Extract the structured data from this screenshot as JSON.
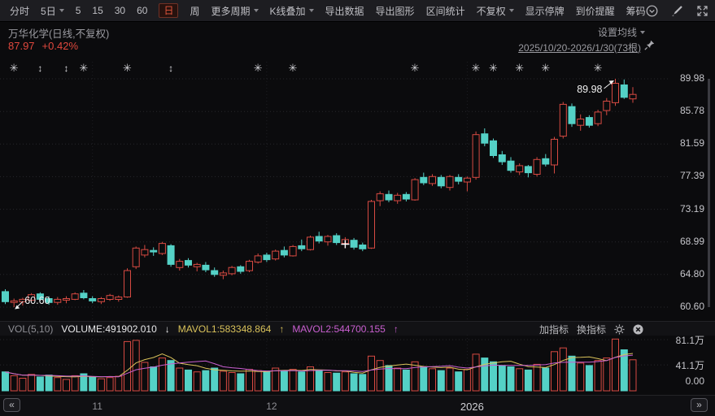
{
  "toolbar": {
    "items": [
      {
        "label": "分时"
      },
      {
        "label": "5日",
        "caret": true
      },
      {
        "label": "5"
      },
      {
        "label": "15"
      },
      {
        "label": "30"
      },
      {
        "label": "60"
      },
      {
        "label": "日",
        "active": true
      },
      {
        "label": "周"
      },
      {
        "label": "更多周期",
        "caret": true
      },
      {
        "label": "K线叠加",
        "caret": true
      },
      {
        "label": "导出数据"
      },
      {
        "label": "导出图形"
      },
      {
        "label": "区间统计"
      },
      {
        "label": "不复权",
        "caret": true
      },
      {
        "label": "显示停牌"
      },
      {
        "label": "到价提醒"
      },
      {
        "label": "筹码"
      }
    ]
  },
  "header": {
    "symbol_title": "万华化学(日线,不复权)",
    "last_price": "87.97",
    "change_pct": "+0.42%",
    "ma_settings": "设置均线",
    "range_label": "2025/10/20-2026/1/30(73根)"
  },
  "vol_header": {
    "indicator": "VOL(5,10)",
    "volume_label": "VOLUME:491902.010",
    "volume_arrow": "↓",
    "mavol1_label": "MAVOL1:583348.864",
    "mavol1_arrow": "↑",
    "mavol2_label": "MAVOL2:544700.155",
    "mavol2_arrow": "↑",
    "add_indicator": "加指标",
    "switch_indicator": "换指标"
  },
  "icons": {
    "star": "✳",
    "updown": "↕",
    "chevrons_left": "«",
    "chevrons_right": "»"
  },
  "colors": {
    "up": "#d74a42",
    "down": "#54d1c6",
    "mavol1": "#d9c25a",
    "mavol2": "#c95fd0",
    "grid": "#27272c",
    "marker": "#d4d4d8",
    "annotation": "#f0f0f0",
    "price_text": "#e0483d",
    "active_tab": "#e2563c"
  },
  "chart_data": {
    "type": "candlestick+volume",
    "symbol": "万华化学",
    "period": "日线",
    "adjustment": "不复权",
    "visible_range": "2025/10/20-2026/1/30",
    "bars_count": 73,
    "last_price": 87.97,
    "change_pct": "+0.42%",
    "price_axis_ticks": [
      "89.98",
      "85.78",
      "81.59",
      "77.39",
      "73.19",
      "68.99",
      "64.80",
      "60.60"
    ],
    "volume_axis_ticks": [
      "81.1万",
      "41.1万",
      "0.00"
    ],
    "x_axis_labels": [
      {
        "label": "11",
        "index": 10
      },
      {
        "label": "12",
        "index": 30
      },
      {
        "label": "2026",
        "index": 53,
        "year": true
      }
    ],
    "annotations": {
      "low_label": "60.60",
      "high_label": "89.98"
    },
    "event_cross": {
      "index": 39,
      "price": 68.7
    },
    "markers": [
      {
        "index": 1,
        "type": "star"
      },
      {
        "index": 4,
        "type": "updown"
      },
      {
        "index": 7,
        "type": "updown"
      },
      {
        "index": 9,
        "type": "star"
      },
      {
        "index": 14,
        "type": "star"
      },
      {
        "index": 19,
        "type": "updown"
      },
      {
        "index": 29,
        "type": "star"
      },
      {
        "index": 33,
        "type": "star"
      },
      {
        "index": 47,
        "type": "star"
      },
      {
        "index": 54,
        "type": "star"
      },
      {
        "index": 56,
        "type": "star"
      },
      {
        "index": 59,
        "type": "star"
      },
      {
        "index": 62,
        "type": "star"
      },
      {
        "index": 68,
        "type": "star"
      }
    ],
    "candles": [
      [
        62.6,
        62.9,
        61.0,
        61.3
      ],
      [
        61.2,
        61.7,
        60.6,
        61.4
      ],
      [
        61.3,
        61.8,
        60.8,
        61.6
      ],
      [
        61.5,
        62.4,
        61.3,
        62.2
      ],
      [
        62.3,
        62.5,
        61.4,
        61.6
      ],
      [
        61.7,
        62.0,
        60.9,
        61.2
      ],
      [
        61.2,
        61.9,
        60.9,
        61.6
      ],
      [
        61.5,
        62.0,
        61.1,
        61.7
      ],
      [
        61.6,
        62.5,
        61.5,
        62.3
      ],
      [
        62.4,
        62.8,
        61.6,
        61.8
      ],
      [
        61.7,
        62.0,
        61.1,
        61.4
      ],
      [
        61.3,
        61.9,
        61.0,
        61.7
      ],
      [
        61.6,
        62.3,
        61.4,
        62.1
      ],
      [
        61.6,
        62.1,
        61.3,
        61.9
      ],
      [
        61.9,
        65.6,
        61.8,
        65.3
      ],
      [
        65.8,
        68.4,
        65.5,
        68.2
      ],
      [
        67.3,
        68.6,
        67.0,
        68.0
      ],
      [
        67.9,
        68.3,
        67.2,
        67.7
      ],
      [
        67.5,
        69.0,
        67.3,
        68.8
      ],
      [
        68.5,
        68.7,
        65.8,
        66.1
      ],
      [
        65.7,
        66.8,
        65.3,
        66.5
      ],
      [
        66.6,
        66.9,
        65.7,
        66.0
      ],
      [
        65.8,
        66.3,
        65.2,
        66.1
      ],
      [
        66.0,
        66.4,
        65.1,
        65.4
      ],
      [
        65.3,
        65.7,
        64.5,
        64.8
      ],
      [
        64.7,
        65.3,
        64.2,
        65.0
      ],
      [
        64.9,
        65.9,
        64.7,
        65.7
      ],
      [
        65.8,
        66.0,
        64.9,
        65.2
      ],
      [
        65.3,
        66.7,
        65.1,
        66.5
      ],
      [
        66.4,
        67.5,
        66.2,
        67.2
      ],
      [
        67.3,
        67.6,
        66.4,
        66.7
      ],
      [
        66.8,
        68.0,
        66.6,
        67.8
      ],
      [
        67.9,
        68.4,
        67.0,
        67.3
      ],
      [
        67.2,
        68.6,
        67.1,
        68.4
      ],
      [
        68.5,
        69.3,
        67.8,
        68.1
      ],
      [
        68.0,
        69.8,
        67.9,
        69.6
      ],
      [
        69.7,
        70.3,
        68.8,
        69.1
      ],
      [
        69.0,
        69.9,
        68.5,
        69.7
      ],
      [
        69.8,
        70.1,
        68.6,
        68.9
      ],
      [
        68.8,
        69.6,
        68.2,
        69.3
      ],
      [
        69.2,
        69.5,
        68.0,
        68.3
      ],
      [
        68.6,
        68.9,
        67.8,
        68.1
      ],
      [
        68.2,
        74.4,
        68.1,
        74.2
      ],
      [
        74.3,
        75.5,
        73.6,
        75.2
      ],
      [
        75.1,
        75.6,
        74.1,
        74.4
      ],
      [
        74.3,
        75.3,
        73.9,
        75.0
      ],
      [
        75.1,
        75.4,
        74.2,
        74.5
      ],
      [
        74.4,
        77.2,
        74.3,
        77.0
      ],
      [
        77.3,
        77.9,
        76.3,
        76.6
      ],
      [
        76.5,
        77.7,
        76.2,
        77.4
      ],
      [
        77.3,
        77.6,
        75.9,
        76.2
      ],
      [
        76.0,
        77.6,
        75.6,
        77.4
      ],
      [
        77.3,
        77.7,
        76.4,
        76.8
      ],
      [
        76.7,
        77.4,
        75.5,
        77.2
      ],
      [
        77.3,
        83.2,
        77.0,
        82.8
      ],
      [
        82.9,
        83.6,
        81.3,
        81.7
      ],
      [
        82.0,
        82.3,
        79.8,
        80.1
      ],
      [
        80.2,
        80.7,
        78.9,
        79.3
      ],
      [
        79.4,
        79.9,
        77.9,
        78.2
      ],
      [
        78.0,
        79.1,
        77.6,
        78.8
      ],
      [
        78.7,
        78.9,
        77.3,
        77.9
      ],
      [
        77.7,
        79.9,
        77.4,
        79.6
      ],
      [
        79.7,
        80.3,
        78.7,
        79.0
      ],
      [
        78.9,
        82.5,
        77.8,
        82.2
      ],
      [
        82.6,
        87.0,
        82.3,
        86.7
      ],
      [
        86.4,
        86.8,
        83.8,
        84.2
      ],
      [
        84.0,
        85.4,
        83.3,
        84.8
      ],
      [
        85.0,
        85.3,
        83.7,
        84.0
      ],
      [
        84.2,
        86.0,
        83.9,
        85.7
      ],
      [
        85.9,
        87.5,
        85.3,
        87.1
      ],
      [
        86.9,
        89.98,
        86.5,
        89.4
      ],
      [
        89.2,
        89.9,
        87.4,
        87.6
      ],
      [
        87.4,
        88.9,
        86.9,
        87.97
      ]
    ],
    "volumes_wan": [
      30,
      24,
      20,
      26,
      22,
      25,
      21,
      18,
      24,
      27,
      22,
      19,
      21,
      23,
      78,
      80,
      45,
      38,
      52,
      48,
      36,
      33,
      30,
      32,
      36,
      31,
      29,
      27,
      34,
      32,
      30,
      36,
      31,
      34,
      30,
      38,
      33,
      29,
      28,
      30,
      27,
      26,
      55,
      48,
      40,
      36,
      33,
      46,
      38,
      35,
      32,
      36,
      30,
      34,
      58,
      52,
      46,
      40,
      38,
      35,
      33,
      42,
      36,
      62,
      68,
      55,
      44,
      40,
      48,
      52,
      82,
      65,
      49.2
    ],
    "indicator": {
      "name": "VOL(5,10)",
      "volume": "491902.010",
      "mavol1": "583348.864",
      "mavol2": "544700.155"
    }
  }
}
